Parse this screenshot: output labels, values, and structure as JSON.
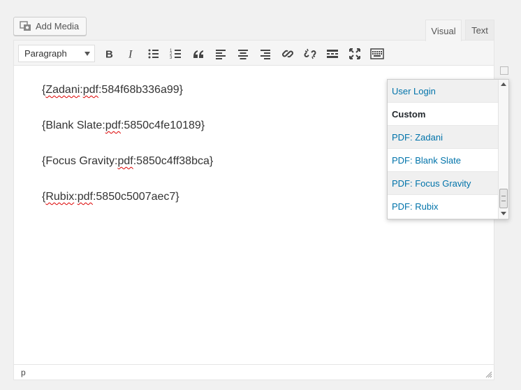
{
  "add_media": {
    "label": "Add Media",
    "icon": "media-icon"
  },
  "tabs": {
    "visual": "Visual",
    "text": "Text"
  },
  "toolbar": {
    "format": "Paragraph",
    "buttons": [
      "bold-icon",
      "italic-icon",
      "bullet-list-icon",
      "numbered-list-icon",
      "blockquote-icon",
      "align-left-icon",
      "align-center-icon",
      "align-right-icon",
      "link-icon",
      "unlink-icon",
      "read-more-icon",
      "fullscreen-icon",
      "toolbar-toggle-icon"
    ]
  },
  "content": {
    "line1": {
      "open": "{",
      "name": "Zadani",
      "sep1": ":",
      "kw": "pdf",
      "rest": ":584f68b336a99}"
    },
    "line2": {
      "open": "{Blank Slate:",
      "kw": "pdf",
      "rest": ":5850c4fe10189}"
    },
    "line3": {
      "open": "{Focus Gravity:",
      "kw": "pdf",
      "rest": ":5850c4ff38bca}"
    },
    "line4": {
      "open": "{",
      "name": "Rubix",
      "sep1": ":",
      "kw": "pdf",
      "rest": ":5850c5007aec7}"
    }
  },
  "status": {
    "path": "p"
  },
  "dropdown": {
    "items": [
      {
        "label": "User Login",
        "type": "link"
      },
      {
        "label": "Custom",
        "type": "header"
      },
      {
        "label": "PDF: Zadani",
        "type": "link"
      },
      {
        "label": "PDF: Blank Slate",
        "type": "link"
      },
      {
        "label": "PDF: Focus Gravity",
        "type": "link"
      },
      {
        "label": "PDF: Rubix",
        "type": "link"
      }
    ]
  },
  "colors": {
    "link": "#0073aa",
    "text": "#333333",
    "toolbar_bg": "#f5f5f5"
  }
}
